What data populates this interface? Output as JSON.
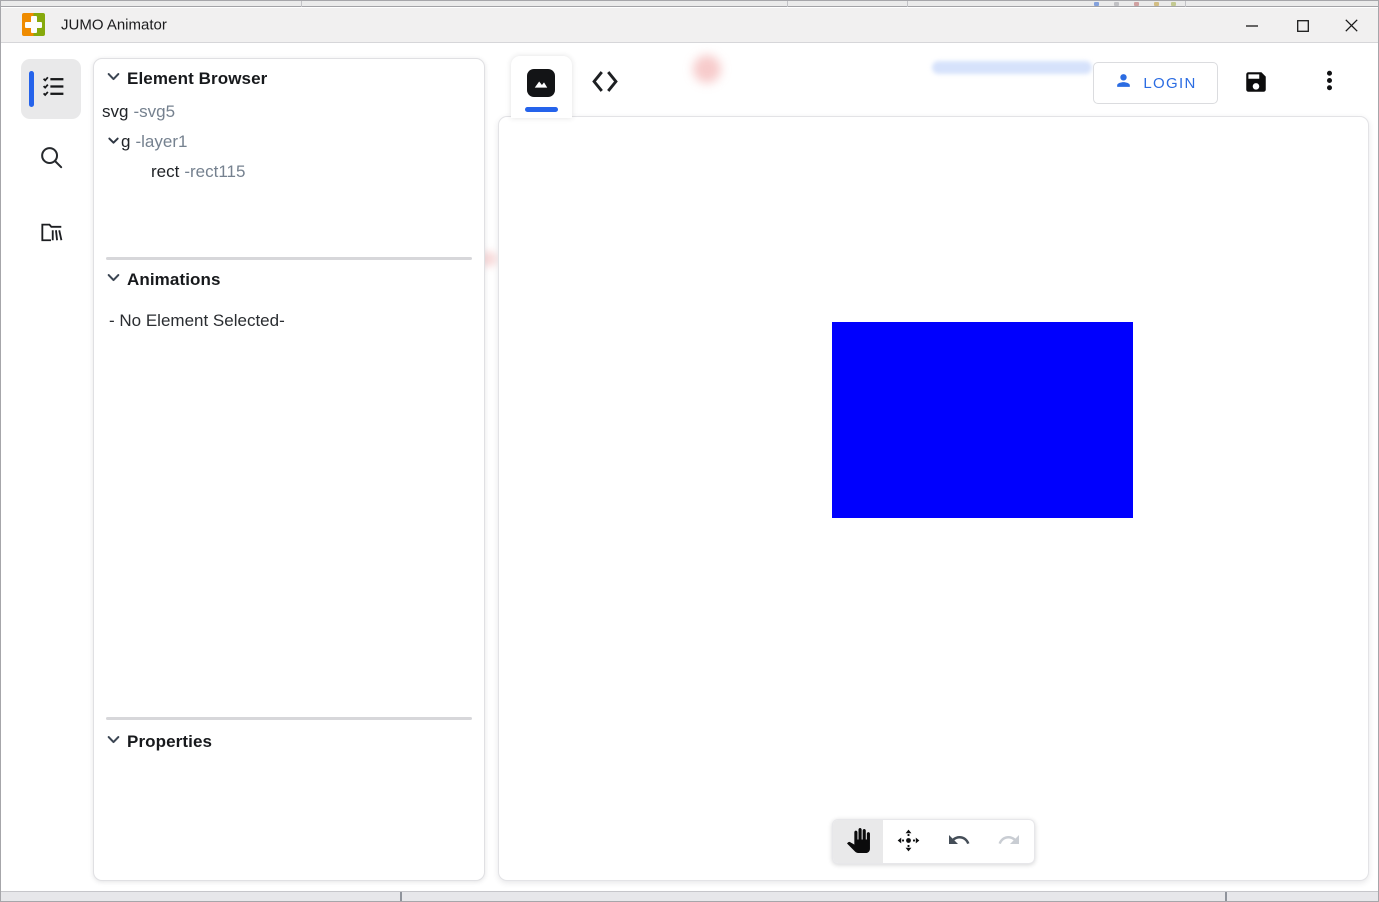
{
  "window": {
    "title": "JUMO Animator",
    "controls": {
      "minimize": "minimize",
      "maximize": "maximize",
      "close": "close"
    }
  },
  "sidebar": {
    "items": [
      {
        "label": "elements",
        "icon": "checklist-icon",
        "selected": true
      },
      {
        "label": "search",
        "icon": "search-icon",
        "selected": false
      },
      {
        "label": "library",
        "icon": "folder-library-icon",
        "selected": false
      }
    ]
  },
  "element_browser": {
    "title": "Element Browser",
    "tree": [
      {
        "tag": "svg",
        "id": "-svg5",
        "depth": 0,
        "expanded": false
      },
      {
        "tag": "g",
        "id": "-layer1",
        "depth": 1,
        "expanded": true
      },
      {
        "tag": "rect",
        "id": "-rect115",
        "depth": 2,
        "expanded": false
      }
    ]
  },
  "animations": {
    "title": "Animations",
    "empty_text": "- No Element Selected-"
  },
  "properties": {
    "title": "Properties"
  },
  "editor": {
    "tabs": [
      {
        "name": "canvas-view",
        "icon": "image-icon",
        "selected": true
      },
      {
        "name": "code-view",
        "icon": "code-icon",
        "selected": false
      }
    ],
    "login_label": "LOGIN",
    "canvas": {
      "rect_style": "background:#0000fe",
      "rect_color": "#0000fe"
    },
    "toolbar": [
      {
        "name": "pan",
        "icon": "hand-icon",
        "selected": true,
        "enabled": true
      },
      {
        "name": "move",
        "icon": "move-arrows-icon",
        "selected": false,
        "enabled": true
      },
      {
        "name": "undo",
        "icon": "undo-icon",
        "selected": false,
        "enabled": true
      },
      {
        "name": "redo",
        "icon": "redo-icon",
        "selected": false,
        "enabled": false
      }
    ]
  },
  "icon_names": [
    "app-plus-logo-icon",
    "minimize-icon",
    "maximize-icon",
    "close-icon",
    "checklist-icon",
    "search-icon",
    "folder-library-icon",
    "chevron-down-icon",
    "image-icon",
    "code-icon",
    "person-icon",
    "save-icon",
    "kebab-menu-icon",
    "hand-icon",
    "move-arrows-icon",
    "undo-icon",
    "redo-icon"
  ],
  "colors": {
    "accent_blue": "#2563eb",
    "login_blue": "#2b6ce2",
    "rect_blue": "#0000fe",
    "titlebar_gray": "#f1f0f0",
    "selected_gray": "#e9e9ea"
  }
}
